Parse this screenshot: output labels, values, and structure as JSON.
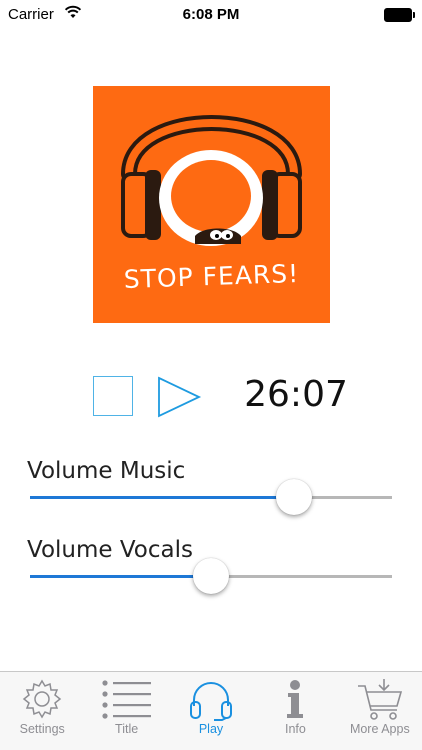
{
  "status_bar": {
    "carrier": "Carrier",
    "time": "6:08 PM"
  },
  "album": {
    "title_text": "STOP FEARS!",
    "background_color": "#fe6a12"
  },
  "player": {
    "stop_icon": "stop-icon",
    "play_icon": "play-icon",
    "time": "26:07",
    "accent_color": "#4fb3e6"
  },
  "volume_music": {
    "label": "Volume Music",
    "level": 0.73
  },
  "volume_vocals": {
    "label": "Volume Vocals",
    "level": 0.5
  },
  "tab_bar": {
    "active_color": "#1a90e0",
    "inactive_color": "#8e8e93",
    "tabs": [
      {
        "label": "Settings",
        "icon": "gear-icon"
      },
      {
        "label": "Title",
        "icon": "list-icon"
      },
      {
        "label": "Play",
        "icon": "headphones-icon",
        "active": true
      },
      {
        "label": "Info",
        "icon": "info-icon"
      },
      {
        "label": "More Apps",
        "icon": "cart-icon"
      }
    ]
  }
}
